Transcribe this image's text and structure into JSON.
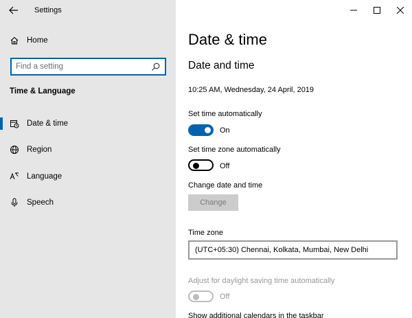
{
  "window": {
    "app_title": "Settings"
  },
  "sidebar": {
    "home_label": "Home",
    "search": {
      "placeholder": "Find a setting"
    },
    "section_heading": "Time & Language",
    "items": [
      {
        "label": "Date & time",
        "icon": "calendar-clock-icon",
        "active": true
      },
      {
        "label": "Region",
        "icon": "globe-icon",
        "active": false
      },
      {
        "label": "Language",
        "icon": "language-icon",
        "active": false
      },
      {
        "label": "Speech",
        "icon": "microphone-icon",
        "active": false
      }
    ]
  },
  "main": {
    "page_title": "Date & time",
    "subtitle": "Date and time",
    "current_datetime": "10:25 AM, Wednesday, 24 April, 2019",
    "set_time_auto": {
      "label": "Set time automatically",
      "state": "On"
    },
    "set_tz_auto": {
      "label": "Set time zone automatically",
      "state": "Off"
    },
    "change_dt": {
      "label": "Change date and time",
      "button": "Change"
    },
    "time_zone": {
      "label": "Time zone",
      "value": "(UTC+05:30) Chennai, Kolkata, Mumbai, New Delhi"
    },
    "dst": {
      "label": "Adjust for daylight saving time automatically",
      "state": "Off"
    },
    "calendars_label": "Show additional calendars in the taskbar"
  },
  "colors": {
    "accent": "#0063b1",
    "sidebar_bg": "#e6e6e6",
    "disabled": "#999999"
  }
}
